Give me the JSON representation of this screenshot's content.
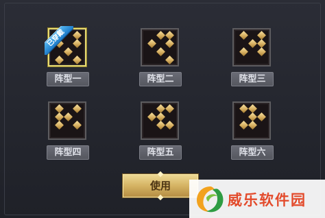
{
  "formations": [
    {
      "label": "阵型一",
      "selected": true,
      "dots": [
        [
          2,
          0
        ],
        [
          0,
          1
        ],
        [
          2,
          1
        ],
        [
          1,
          2
        ],
        [
          0,
          3
        ],
        [
          2,
          3
        ]
      ]
    },
    {
      "label": "阵型二",
      "selected": false,
      "dots": [
        [
          1,
          0
        ],
        [
          2,
          0
        ],
        [
          0,
          1
        ],
        [
          2,
          1
        ],
        [
          1,
          2
        ],
        [
          2,
          3
        ]
      ]
    },
    {
      "label": "阵型三",
      "selected": false,
      "dots": [
        [
          0,
          0
        ],
        [
          2,
          0
        ],
        [
          1,
          1
        ],
        [
          2,
          1
        ],
        [
          0,
          2
        ],
        [
          2,
          2
        ]
      ]
    },
    {
      "label": "阵型四",
      "selected": false,
      "dots": [
        [
          0,
          0
        ],
        [
          2,
          0
        ],
        [
          0,
          1
        ],
        [
          1,
          1
        ],
        [
          0,
          2
        ],
        [
          2,
          2
        ]
      ]
    },
    {
      "label": "阵型五",
      "selected": false,
      "dots": [
        [
          1,
          0
        ],
        [
          2,
          0
        ],
        [
          0,
          1
        ],
        [
          1,
          1
        ],
        [
          1,
          2
        ],
        [
          2,
          2
        ]
      ]
    },
    {
      "label": "阵型六",
      "selected": false,
      "dots": [
        [
          0,
          0
        ],
        [
          1,
          0
        ],
        [
          1,
          1
        ],
        [
          2,
          1
        ],
        [
          0,
          2
        ],
        [
          1,
          2
        ]
      ]
    }
  ],
  "equipped_badge": "已穿戴",
  "use_button_label": "使用",
  "watermark_text": "威乐软件园",
  "colors": {
    "piece_gold": "#d7af60",
    "selected_border": "#e6da72",
    "badge_blue": "#1c79c7",
    "button_gold": "#d5b363"
  }
}
